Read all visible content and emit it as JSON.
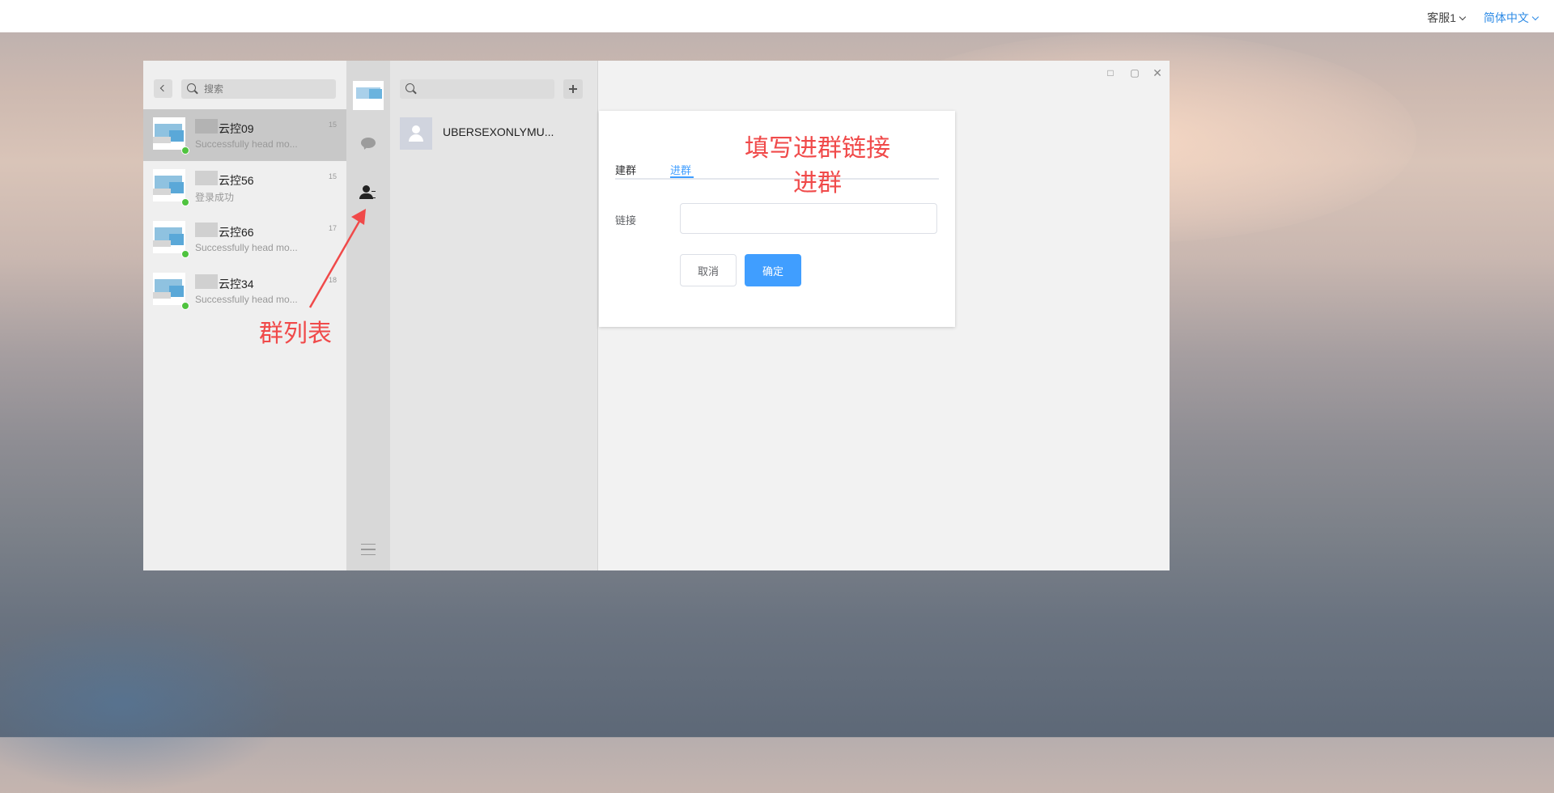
{
  "topbar": {
    "account": "客服1",
    "language": "简体中文"
  },
  "sessions": [
    {
      "name": "云控09",
      "time": "15",
      "message": "Successfully head mo...",
      "active": true
    },
    {
      "name": "云控56",
      "time": "15",
      "message": "登录成功",
      "active": false
    },
    {
      "name": "云控66",
      "time": "17",
      "message": "Successfully head mo...",
      "active": false
    },
    {
      "name": "云控34",
      "time": "18",
      "message": "Successfully head mo...",
      "active": false
    }
  ],
  "session_search": {
    "placeholder": "搜索"
  },
  "group_list": {
    "items": [
      {
        "name": "UBERSEXONLYMU..."
      }
    ]
  },
  "dialog": {
    "tabs": [
      {
        "label": "建群"
      },
      {
        "label": "进群",
        "active": true
      }
    ],
    "field_label": "链接",
    "cancel_label": "取消",
    "ok_label": "确定"
  },
  "annotations": {
    "fill_link": "填写进群链接",
    "join_group": "进群",
    "group_list": "群列表"
  },
  "colors": {
    "accent": "#409eff",
    "annotation": "#f04a4a",
    "online": "#4fc33f"
  }
}
